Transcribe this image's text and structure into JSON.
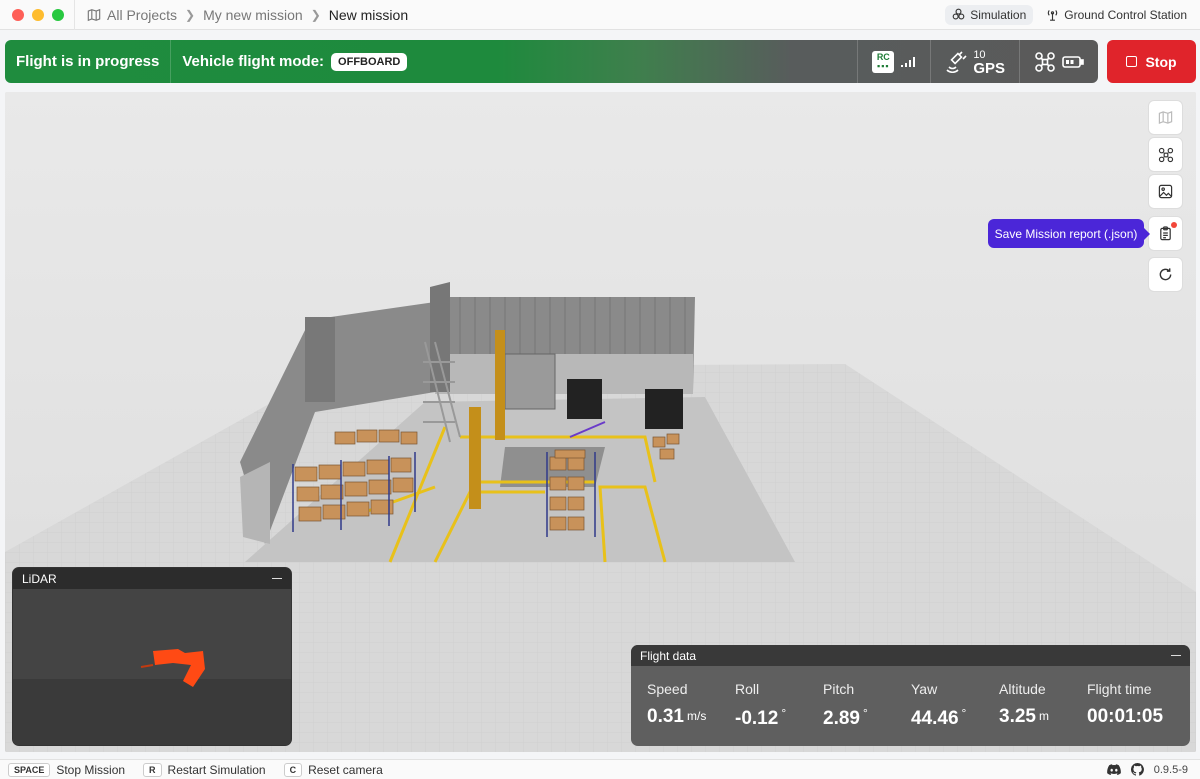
{
  "breadcrumb": {
    "items": [
      "All Projects",
      "My new mission",
      "New mission"
    ]
  },
  "topbar": {
    "simulation_label": "Simulation",
    "gcs_label": "Ground Control Station"
  },
  "status": {
    "flight_state": "Flight is in progress",
    "mode_label": "Vehicle flight mode:",
    "mode_value": "OFFBOARD",
    "rc_label": "RC",
    "gps_count": "10",
    "gps_label": "GPS",
    "stop_label": "Stop",
    "colors": {
      "progress_green": "#1f8c3e",
      "stop_red": "#e0242b"
    }
  },
  "toolbar": {
    "tooltip": "Save Mission report (.json)",
    "icons": [
      "map-icon",
      "drone-icon",
      "image-icon",
      "clipboard-icon",
      "refresh-icon"
    ]
  },
  "lidar": {
    "title": "LiDAR"
  },
  "flight_data": {
    "title": "Flight data",
    "metrics": [
      {
        "label": "Speed",
        "value": "0.31",
        "unit": "m/s"
      },
      {
        "label": "Roll",
        "value": "-0.12",
        "unit": "°"
      },
      {
        "label": "Pitch",
        "value": "2.89",
        "unit": "°"
      },
      {
        "label": "Yaw",
        "value": "44.46",
        "unit": "°"
      },
      {
        "label": "Altitude",
        "value": "3.25",
        "unit": "m"
      },
      {
        "label": "Flight time",
        "value": "00:01:05",
        "unit": ""
      }
    ]
  },
  "shortcuts": [
    {
      "key": "SPACE",
      "label": "Stop Mission"
    },
    {
      "key": "R",
      "label": "Restart Simulation"
    },
    {
      "key": "C",
      "label": "Reset camera"
    }
  ],
  "version": "0.9.5-9"
}
